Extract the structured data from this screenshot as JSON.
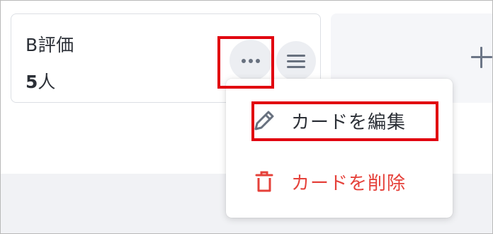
{
  "card": {
    "title": "B評価",
    "count_number": "5",
    "count_unit": "人"
  },
  "card_actions": {
    "more_icon": "ellipsis-icon",
    "drag_icon": "hamburger-icon"
  },
  "add_column": {
    "icon": "plus-icon"
  },
  "context_menu": {
    "items": [
      {
        "label": "カードを編集",
        "icon": "pencil-icon",
        "color": "#2b2f36"
      },
      {
        "label": "カードを削除",
        "icon": "trash-icon",
        "color": "#e5413a"
      }
    ]
  },
  "highlight_color": "#e1020f"
}
